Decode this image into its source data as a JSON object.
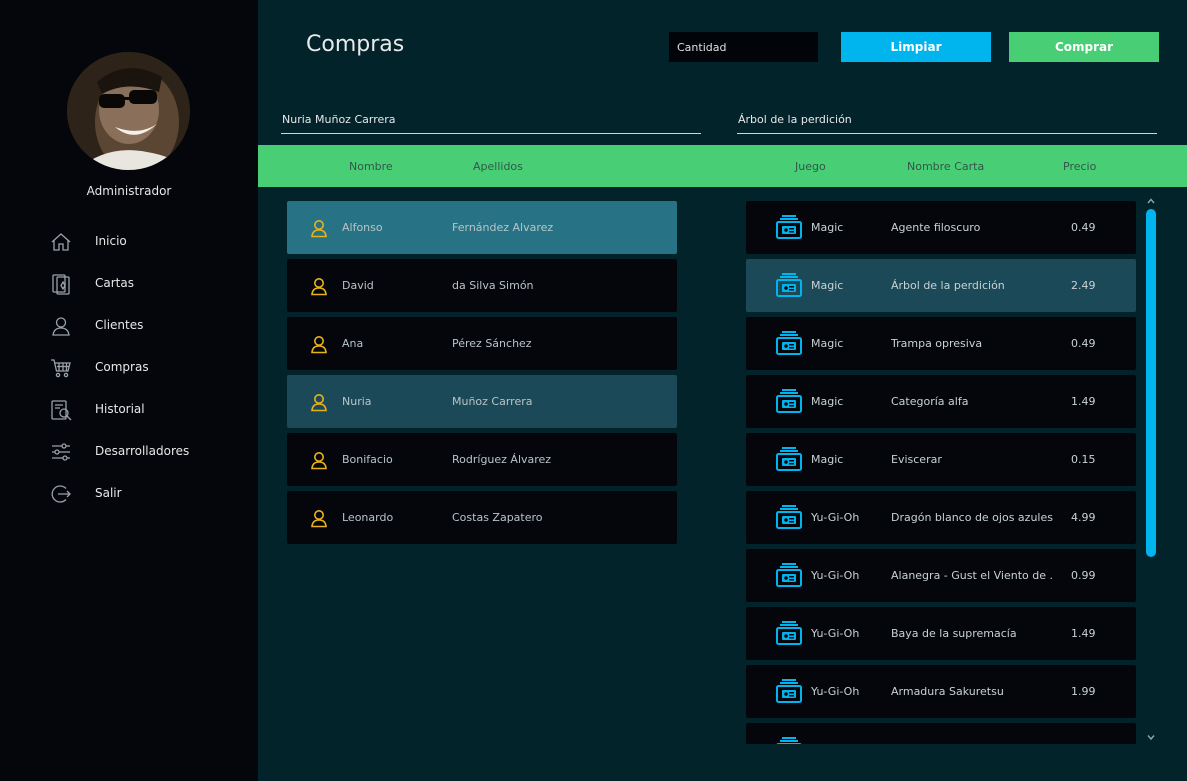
{
  "sidebar": {
    "user_name": "Administrador",
    "items": [
      {
        "label": "Inicio",
        "icon": "home-icon"
      },
      {
        "label": "Cartas",
        "icon": "cards-icon"
      },
      {
        "label": "Clientes",
        "icon": "user-icon"
      },
      {
        "label": "Compras",
        "icon": "cart-icon"
      },
      {
        "label": "Historial",
        "icon": "history-icon"
      },
      {
        "label": "Desarrolladores",
        "icon": "sliders-icon"
      },
      {
        "label": "Salir",
        "icon": "logout-icon"
      }
    ]
  },
  "header": {
    "title": "Compras",
    "quantity_placeholder": "Cantidad",
    "clear_label": "Limpiar",
    "buy_label": "Comprar"
  },
  "selection": {
    "client": "Nuria Muñoz Carrera",
    "card": "Árbol de la perdición"
  },
  "columns": {
    "name": "Nombre",
    "surname": "Apellidos",
    "game": "Juego",
    "card_name": "Nombre Carta",
    "price": "Precio"
  },
  "clients": [
    {
      "first": "Alfonso",
      "last": "Fernández Alvarez",
      "state": "hover"
    },
    {
      "first": "David",
      "last": "da Silva Simón",
      "state": ""
    },
    {
      "first": "Ana",
      "last": "Pérez Sánchez",
      "state": ""
    },
    {
      "first": "Nuria",
      "last": "Muñoz Carrera",
      "state": "selected"
    },
    {
      "first": "Bonifacio",
      "last": "Rodríguez Álvarez",
      "state": ""
    },
    {
      "first": "Leonardo",
      "last": "Costas Zapatero",
      "state": ""
    }
  ],
  "cards": [
    {
      "game": "Magic",
      "name": "Agente filoscuro",
      "price": "0.49",
      "state": ""
    },
    {
      "game": "Magic",
      "name": "Árbol de la perdición",
      "price": "2.49",
      "state": "selected"
    },
    {
      "game": "Magic",
      "name": "Trampa opresiva",
      "price": "0.49",
      "state": ""
    },
    {
      "game": "Magic",
      "name": "Categoría alfa",
      "price": "1.49",
      "state": ""
    },
    {
      "game": "Magic",
      "name": "Eviscerar",
      "price": "0.15",
      "state": ""
    },
    {
      "game": "Yu-Gi-Oh",
      "name": "Dragón blanco de ojos azules",
      "price": "4.99",
      "state": ""
    },
    {
      "game": "Yu-Gi-Oh",
      "name": "Alanegra - Gust el Viento de ...",
      "price": "0.99",
      "state": ""
    },
    {
      "game": "Yu-Gi-Oh",
      "name": "Baya de la supremacía",
      "price": "1.49",
      "state": ""
    },
    {
      "game": "Yu-Gi-Oh",
      "name": "Armadura Sakuretsu",
      "price": "1.99",
      "state": ""
    },
    {
      "game": "",
      "name": "",
      "price": "",
      "state": ""
    }
  ],
  "colors": {
    "accent_blue": "#00b4ee",
    "accent_green": "#48cf76",
    "user_icon": "#e8b21a",
    "background": "#03232b",
    "sidebar": "#04060b"
  }
}
